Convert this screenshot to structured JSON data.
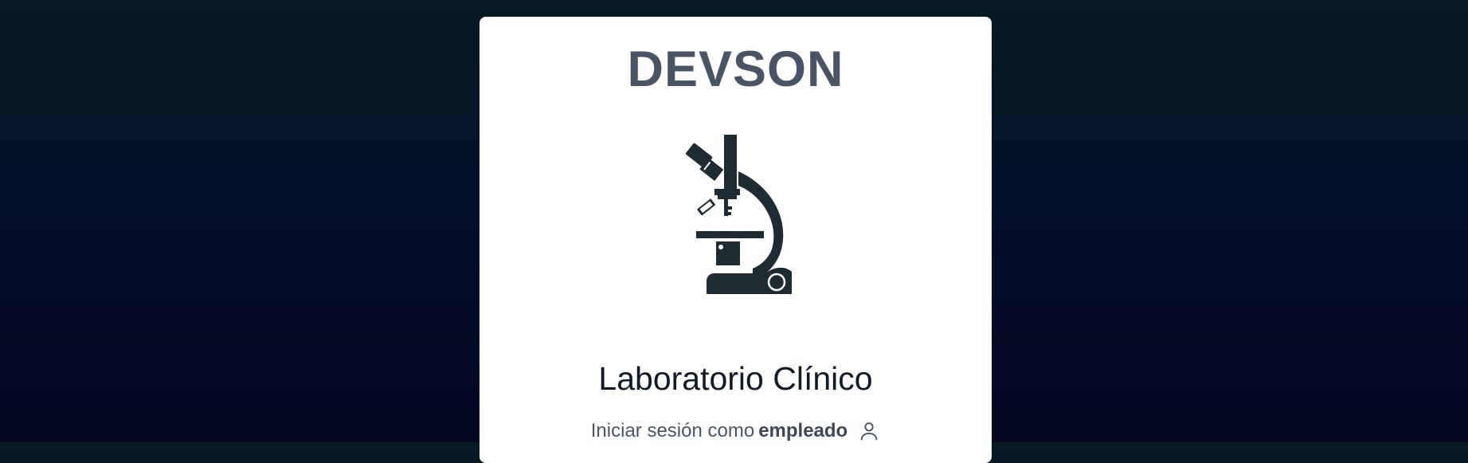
{
  "brand": {
    "title": "DEVSON"
  },
  "logo": {
    "icon": "microscope-icon"
  },
  "lab": {
    "title": "Laboratorio Clínico"
  },
  "login": {
    "prefix": "Iniciar sesión como",
    "role": "empleado",
    "icon": "user-icon"
  },
  "colors": {
    "background_top": "#061a22",
    "background_bottom": "#030720",
    "card": "#ffffff",
    "brand_text": "#4a5467",
    "icon": "#1f2b33"
  }
}
